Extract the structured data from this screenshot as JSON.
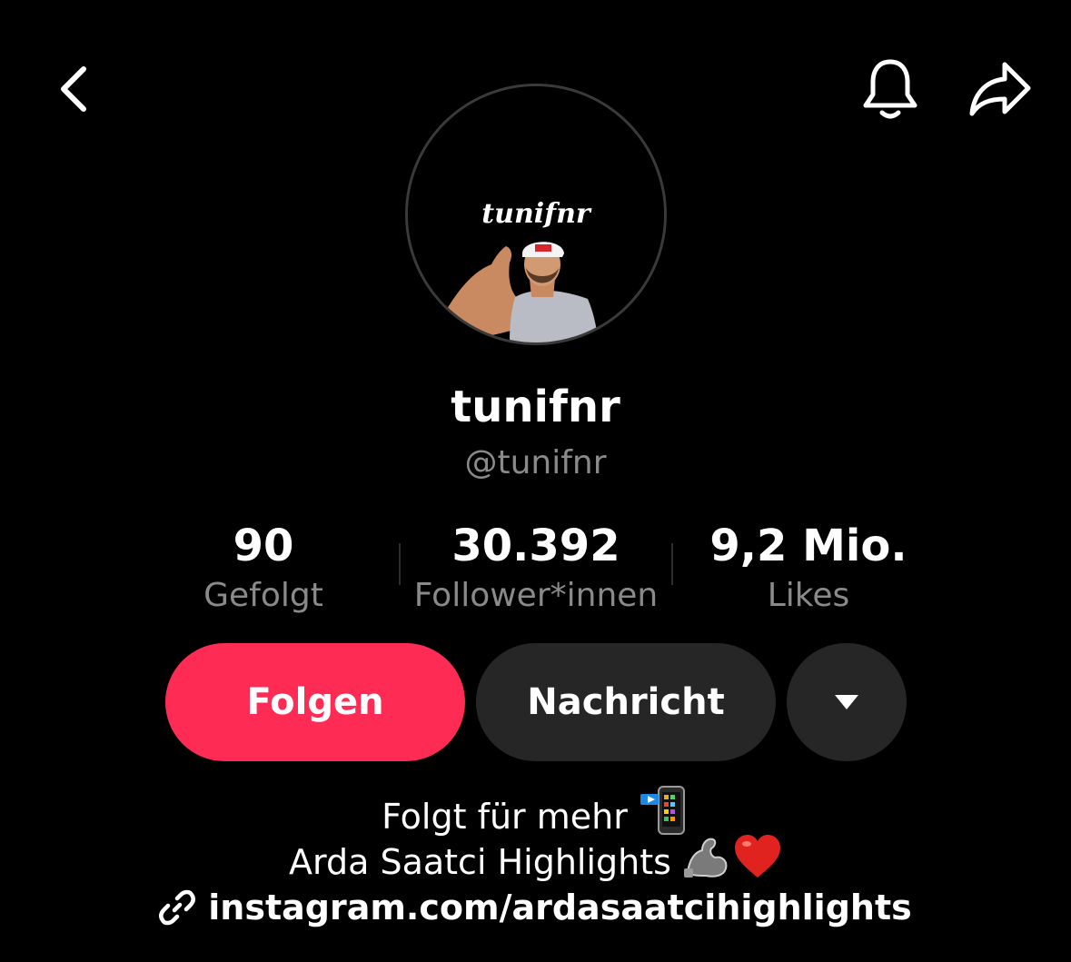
{
  "header": {
    "back_icon": "chevron-left-icon",
    "bell_icon": "bell-icon",
    "share_icon": "share-arrow-icon"
  },
  "profile": {
    "avatar_caption": "tunifnr",
    "display_name": "tunifnr",
    "handle": "@tunifnr"
  },
  "stats": {
    "following": {
      "value": "90",
      "label": "Gefolgt"
    },
    "followers": {
      "value": "30.392",
      "label": "Follower*innen"
    },
    "likes": {
      "value": "9,2 Mio.",
      "label": "Likes"
    }
  },
  "actions": {
    "follow_label": "Folgen",
    "message_label": "Nachricht",
    "more_icon": "caret-down-icon"
  },
  "bio": {
    "line1": "Folgt für mehr",
    "line1_emoji": "mobile-phone-arrow-icon",
    "line2": "Arda Saatci Highlights",
    "line2_emojis": [
      "flexed-biceps-icon",
      "red-heart-icon"
    ],
    "link_icon": "link-icon",
    "link": "instagram.com/ardasaatcihighlights"
  },
  "colors": {
    "background": "#000000",
    "primary_button": "#fe2c55",
    "secondary_button": "#262626",
    "muted_text": "#8a8a8a",
    "text": "#ffffff"
  }
}
